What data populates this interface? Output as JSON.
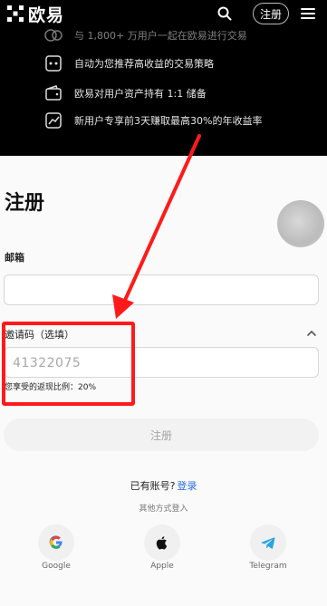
{
  "header": {
    "brand": "欧易",
    "register_label": "注册"
  },
  "promo": {
    "items": [
      {
        "icon": "people-circle-icon",
        "text": "与 1,800+ 万用户一起在欧易进行交易"
      },
      {
        "icon": "bot-icon",
        "text": "自动为您推荐高收益的交易策略"
      },
      {
        "icon": "wallet-icon",
        "text": "欧易对用户资产持有 1:1 储备"
      },
      {
        "icon": "chart-icon",
        "text": "新用户专享前3天赚取最高30%的年收益率"
      }
    ]
  },
  "form": {
    "title": "注册",
    "email_label": "邮箱",
    "email_value": "",
    "invite_label": "邀请码（选填）",
    "invite_value": "41322075",
    "rebate_text": "您享受的返现比例：20%",
    "submit_label": "注册"
  },
  "footer": {
    "have_account": "已有账号?",
    "login_link": "登录",
    "other_login": "其他方式登入",
    "social": [
      {
        "icon": "google-icon",
        "label": "Google"
      },
      {
        "icon": "apple-icon",
        "label": "Apple"
      },
      {
        "icon": "telegram-icon",
        "label": "Telegram"
      }
    ]
  },
  "colors": {
    "header_bg": "#000000",
    "link": "#2b6cde",
    "annotation": "#ff1a1a"
  }
}
